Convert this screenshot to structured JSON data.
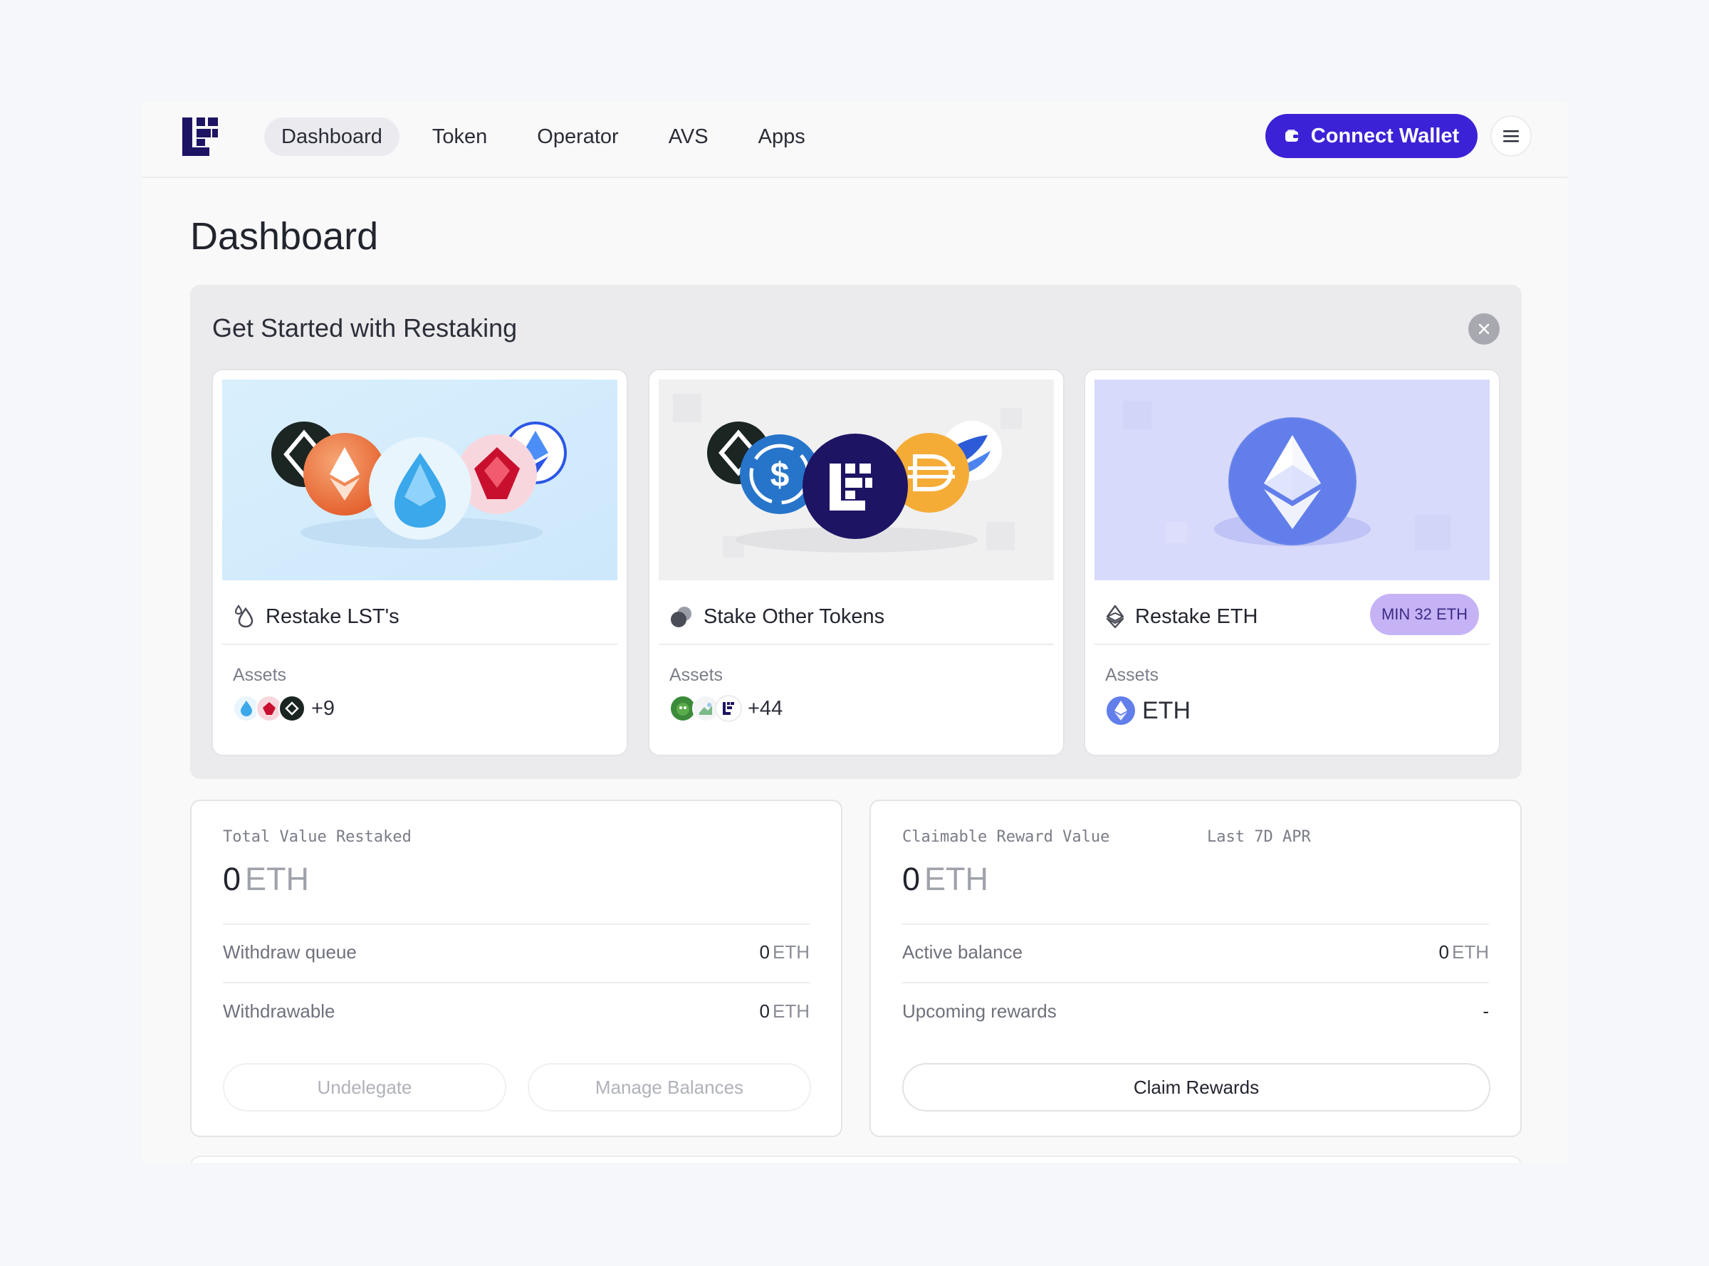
{
  "header": {
    "nav": [
      {
        "label": "Dashboard",
        "active": true
      },
      {
        "label": "Token",
        "active": false
      },
      {
        "label": "Operator",
        "active": false
      },
      {
        "label": "AVS",
        "active": false
      },
      {
        "label": "Apps",
        "active": false
      }
    ],
    "connect_wallet_label": "Connect Wallet"
  },
  "page_title": "Dashboard",
  "get_started": {
    "title": "Get Started with Restaking",
    "cards": [
      {
        "label": "Restake LST's",
        "assets_label": "Assets",
        "assets_more": "+9"
      },
      {
        "label": "Stake Other Tokens",
        "assets_label": "Assets",
        "assets_more": "+44"
      },
      {
        "label": "Restake ETH",
        "badge": "MIN 32 ETH",
        "assets_label": "Assets",
        "asset_name": "ETH"
      }
    ]
  },
  "restaked": {
    "label": "Total Value Restaked",
    "value": "0",
    "unit": "ETH",
    "rows": [
      {
        "label": "Withdraw queue",
        "value": "0",
        "unit": "ETH"
      },
      {
        "label": "Withdrawable",
        "value": "0",
        "unit": "ETH"
      }
    ],
    "undelegate_label": "Undelegate",
    "manage_label": "Manage Balances"
  },
  "rewards": {
    "label": "Claimable Reward Value",
    "apr_label": "Last 7D APR",
    "value": "0",
    "unit": "ETH",
    "rows": [
      {
        "label": "Active balance",
        "value": "0",
        "unit": "ETH"
      },
      {
        "label": "Upcoming rewards",
        "value": "-",
        "unit": ""
      }
    ],
    "claim_label": "Claim Rewards"
  },
  "colors": {
    "brand": "#3b22d6",
    "logo": "#1d1464",
    "badge_bg": "#c6b3f6"
  }
}
